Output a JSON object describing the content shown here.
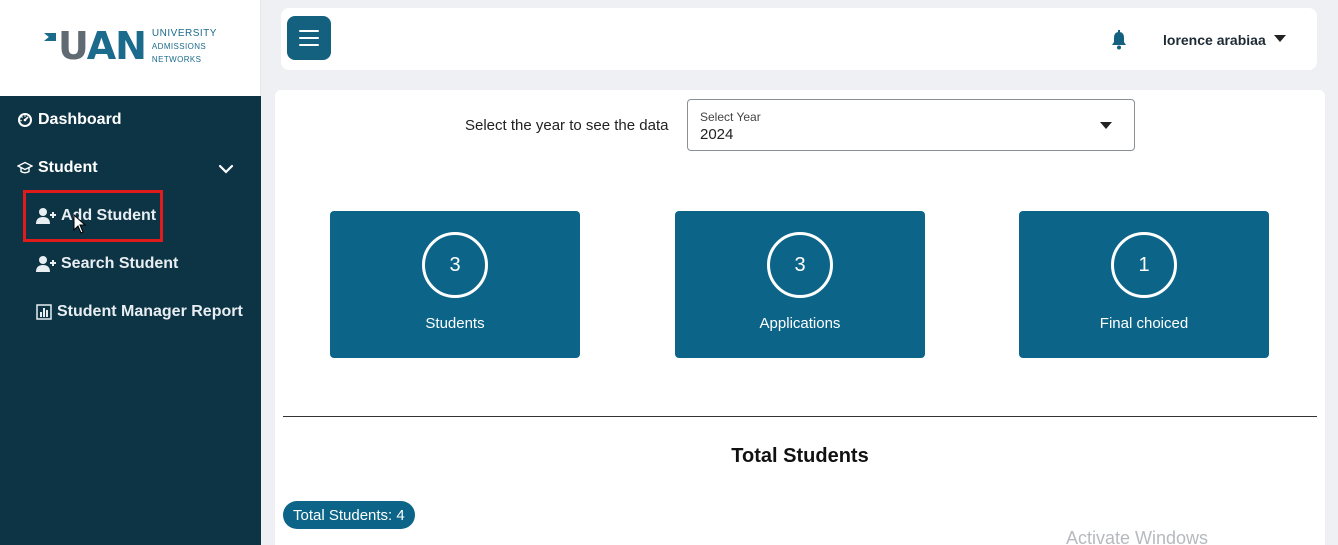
{
  "brand": {
    "logo_letters": [
      "U",
      "A",
      "N"
    ],
    "logo_lines": [
      "UNIVERSITY",
      "ADMISSIONS",
      "NETWORKS"
    ],
    "colors": {
      "primary": "#0c6588",
      "sidebar": "#0d3445",
      "highlight": "#e01b1b"
    }
  },
  "sidebar": {
    "dashboard": {
      "label": "Dashboard",
      "icon": "dashboard-gauge-icon"
    },
    "student": {
      "label": "Student",
      "icon": "graduation-cap-icon",
      "expanded": true
    },
    "sub_items": [
      {
        "label": "Add Student",
        "icon": "user-plus-icon"
      },
      {
        "label": "Search Student",
        "icon": "user-plus-icon"
      },
      {
        "label": "Student Manager Report",
        "icon": "bar-chart-icon"
      }
    ]
  },
  "header": {
    "user_name": "lorence arabiaa",
    "icons": [
      "hamburger-menu-icon",
      "bell-icon",
      "caret-down-icon"
    ]
  },
  "filter": {
    "prompt": "Select the year to see the data",
    "select_label": "Select Year",
    "select_value": "2024"
  },
  "stats": [
    {
      "value": "3",
      "label": "Students"
    },
    {
      "value": "3",
      "label": "Applications"
    },
    {
      "value": "1",
      "label": "Final choiced"
    }
  ],
  "section": {
    "title": "Total Students",
    "badge": "Total Students: 4"
  },
  "watermark": "Activate Windows"
}
